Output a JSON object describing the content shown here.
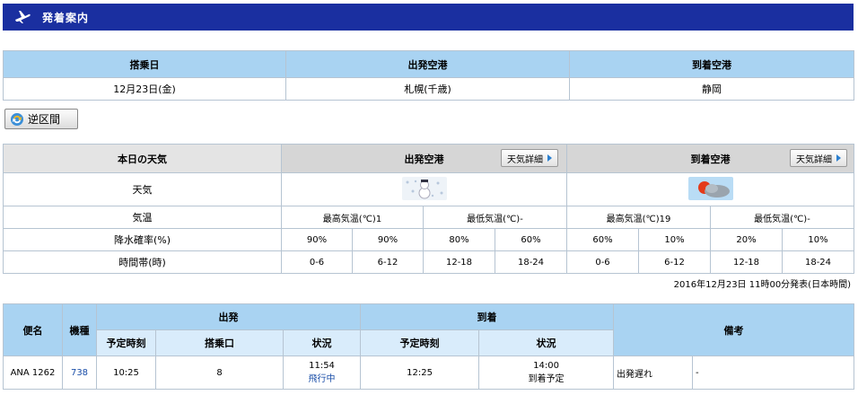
{
  "header": {
    "title": "発着案内"
  },
  "route": {
    "headers": [
      "搭乗日",
      "出発空港",
      "到着空港"
    ],
    "values": [
      "12月23日(金)",
      "札幌(千歳)",
      "静岡"
    ]
  },
  "reverse_button": {
    "label": "逆区間"
  },
  "weather": {
    "title": "本日の天気",
    "dep_label": "出発空港",
    "arr_label": "到着空港",
    "detail_button": "天気詳細",
    "row_weather": "天気",
    "row_temp": "気温",
    "row_rain": "降水確率(%)",
    "row_time": "時間帯(時)",
    "dep": {
      "max": "最高気温(℃)1",
      "min": "最低気温(℃)-",
      "rain": [
        "90%",
        "90%",
        "80%",
        "60%"
      ],
      "icon": "snow-icon"
    },
    "arr": {
      "max": "最高気温(℃)19",
      "min": "最低気温(℃)-",
      "rain": [
        "60%",
        "10%",
        "20%",
        "10%"
      ],
      "icon": "sunny-cloudy-icon"
    },
    "times": [
      "0-6",
      "6-12",
      "12-18",
      "18-24"
    ],
    "issued": "2016年12月23日 11時00分発表(日本時間)"
  },
  "flights": {
    "h_flight": "便名",
    "h_type": "機種",
    "h_dep": "出発",
    "h_arr": "到着",
    "h_remarks": "備考",
    "h_sched": "予定時刻",
    "h_gate": "搭乗口",
    "h_status": "状況",
    "rows": [
      {
        "flight": "ANA 1262",
        "type": "738",
        "dep_time": "10:25",
        "gate": "8",
        "dep_status_time": "11:54",
        "dep_status": "飛行中",
        "arr_time": "12:25",
        "arr_status_time": "14:00",
        "arr_status": "到着予定",
        "remark1": "出発遅れ",
        "remark2": "-"
      }
    ]
  },
  "colors": {
    "header_bg": "#1a2fa0",
    "th_bg": "#a9d3f2",
    "sub_bg": "#d9ecfb",
    "link": "#1a4ea8"
  }
}
